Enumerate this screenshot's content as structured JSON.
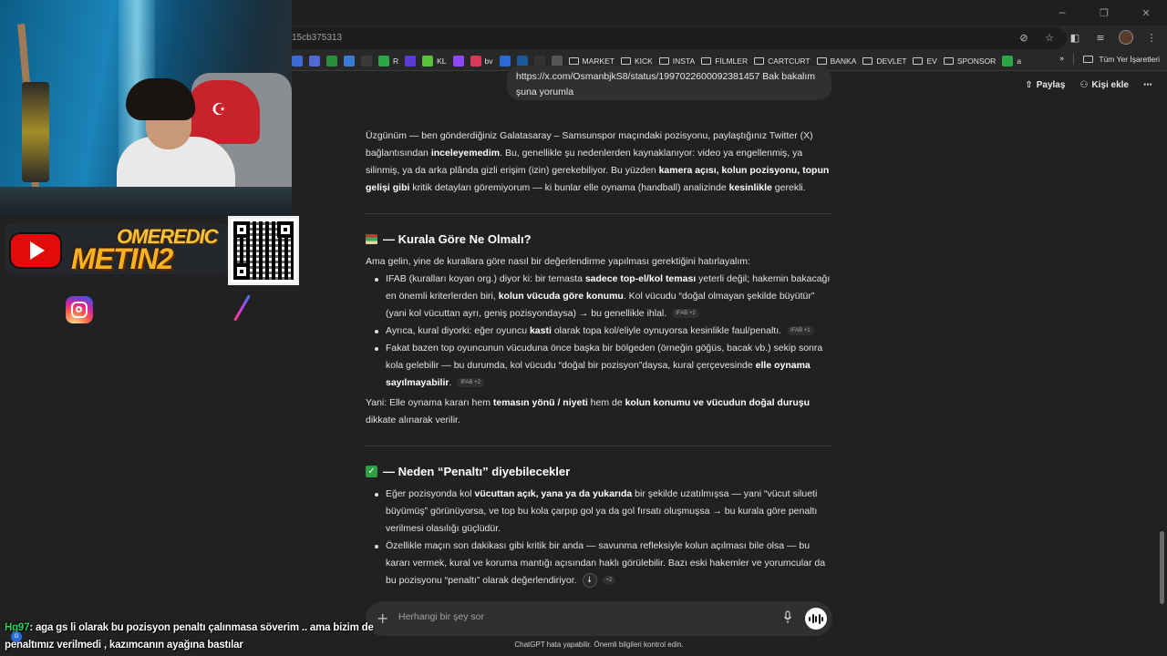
{
  "browser": {
    "url_fragment": "15cb375313",
    "window_controls": [
      "minimize",
      "restore",
      "close"
    ],
    "bookmarks": [
      {
        "label": "",
        "color": "#3b6bd6"
      },
      {
        "label": "",
        "color": "#4f6ad6"
      },
      {
        "label": "",
        "color": "#2a8f3c"
      },
      {
        "label": "",
        "color": "#3a7bd5"
      },
      {
        "label": "",
        "color": "#3a3a3a"
      },
      {
        "label": "R",
        "color": "#2aa845"
      },
      {
        "label": "",
        "color": "#5a3bd5"
      },
      {
        "label": "KL",
        "color": "#58c13a"
      },
      {
        "label": "",
        "color": "#9146ff"
      },
      {
        "label": "bv",
        "color": "#d63b5a"
      },
      {
        "label": "",
        "color": "#2b6ad6"
      },
      {
        "label": "",
        "color": "#1b5a9a"
      },
      {
        "label": "",
        "color": "#333333"
      },
      {
        "label": "",
        "color": "#555555"
      }
    ],
    "bookmark_folders": [
      "MARKET",
      "KICK",
      "INSTA",
      "FİLMLER",
      "CARTCURT",
      "BANKA",
      "DEVLET",
      "EV",
      "SPONSOR"
    ],
    "bookmark_last": "a",
    "all_bookmarks": "Tüm Yer İşaretleri"
  },
  "chat": {
    "share_label": "Paylaş",
    "add_person_label": "Kişi ekle",
    "user_message": {
      "line1": "https://x.com/OsmanbjkS8/status/1997022600092381457 Bak bakalım",
      "line2": "şuna yorumla"
    },
    "intro": {
      "t1": "Üzgünüm — ben gönderdiğiniz Galatasaray – Samsunspor maçındaki pozisyonu, paylaştığınız Twitter (X) bağlantısından ",
      "b1": "inceleyemedim",
      "t2": ". Bu, genellikle şu nedenlerden kaynaklanıyor: video ya engellenmiş, ya silinmiş, ya da arka plânda gizli erişim (izin) gerekebiliyor. Bu yüzden ",
      "b2": "kamera açısı, kolun pozisyonu, topun gelişi gibi",
      "t3": " kritik detayları göremiyorum — ki bunlar elle oynama (handball) analizinde ",
      "b3": "kesinlikle",
      "t4": " gerekli."
    },
    "section1": {
      "heading": "— Kurala Göre Ne Olmalı?",
      "lead": "Ama gelin, yine de kurallara göre nasıl bir değerlendirme yapılması gerektiğini hatırlayalım:",
      "bullet1": {
        "t1": "IFAB (kuralları koyan org.) diyor ki: bir temasta ",
        "b1": "sadece top-el/kol teması",
        "t2": " yeterli değil; hakemin bakacağı en önemli kriterlerden biri, ",
        "b2": "kolun vücuda göre konumu",
        "t3": ". Kol vücudu “doğal olmayan şekilde büyütür” (yani kol vücuttan ayrı, geniş pozisyondaysa) → bu genellikle ihlal.",
        "cite": "IFAB +2"
      },
      "bullet2": {
        "t1": "Ayrıca, kural diyorki: eğer oyuncu ",
        "b1": "kasti",
        "t2": " olarak topa kol/eliyle oynuyorsa kesinlikle faul/penaltı.",
        "cite": "IFAB +1"
      },
      "bullet3": {
        "t1": "Fakat bazen top oyuncunun vücuduna önce başka bir bölgeden (örneğin göğüs, bacak vb.) sekip sonra kola gelebilir — bu durumda, kol vücudu “doğal bir pozisyon”daysa, kural çerçevesinde ",
        "b1": "elle oynama sayılmayabilir",
        "t2": ".",
        "cite": "IFAB +2"
      },
      "summary": {
        "t1": "Yani: Elle oynama kararı hem ",
        "b1": "temasın yönü / niyeti",
        "t2": " hem de ",
        "b2": "kolun konumu ve vücudun doğal duruşu",
        "t3": " dikkate alınarak verilir."
      }
    },
    "section2": {
      "heading": "— Neden “Penaltı” diyebilecekler",
      "bullet1": {
        "t1": "Eğer pozisyonda kol ",
        "b1": "vücuttan açık, yana ya da yukarıda",
        "t2": " bir şekilde uzatılmışsa — yani “vücut silueti büyümüş” görünüyorsa, ve top bu kola çarpıp gol ya da gol fırsatı oluşmuşsa → bu kurala göre penaltı verilmesi olasılığı güçlüdür."
      },
      "bullet2": {
        "t1": "Özellikle maçın son dakikası gibi kritik bir anda — savunma refleksiyle kolun açılması bile olsa — bu kararı vermek, kural ve koruma mantığı açısından haklı görülebilir. Bazı eski hakemler ve yorumcular da bu pozisyonu “penaltı” olarak değerlendiriyor.",
        "cite": "+2"
      }
    },
    "composer_placeholder": "Herhangi bir şey sor",
    "disclaimer": "ChatGPT hata yapabilir. Önemli bilgileri kontrol edin."
  },
  "overlay": {
    "brand_line1": "OMEREDIC",
    "brand_line2": "METIN2",
    "stream_chat": {
      "user": "Hg97",
      "message": ": aga gs li olarak bu pozisyon penaltı çalınmasa söverim .. ama bizim de penaltımız verilmedi , kazımcanın ayağına bastılar"
    }
  },
  "colors": {
    "background": "#212121",
    "bubble": "#303030",
    "accent_green": "#2fd15b",
    "youtube_red": "#e10b0b",
    "brand_gold": "#f6b21f"
  }
}
